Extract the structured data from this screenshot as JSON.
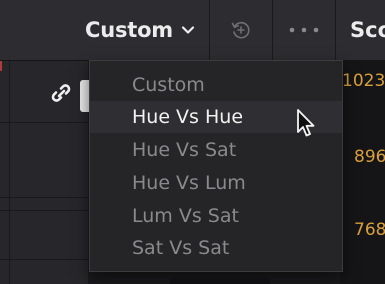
{
  "toolbar": {
    "dropdown_label": "Custom",
    "dropdown_icon": "chevron-down-icon",
    "reset_icon": "reset-icon",
    "more_icon": "more-options-icon",
    "scopes_tab_label": "Sco"
  },
  "dropdown_menu": {
    "items": [
      {
        "label": "Custom",
        "state": "disabled"
      },
      {
        "label": "Hue Vs Hue",
        "state": "hovered"
      },
      {
        "label": "Hue Vs Sat",
        "state": "normal"
      },
      {
        "label": "Hue Vs Lum",
        "state": "normal"
      },
      {
        "label": "Lum Vs Sat",
        "state": "normal"
      },
      {
        "label": "Sat Vs Sat",
        "state": "normal"
      }
    ]
  },
  "left_panel": {
    "link_icon": "link-icon"
  },
  "scope": {
    "labels": [
      "1023",
      "896",
      "768"
    ],
    "label_color": "#d9a03c"
  },
  "colors": {
    "toolbar_bg": "#2d2d31",
    "menu_bg": "#252528",
    "menu_text_active": "#f2f2f2",
    "menu_text_dim": "#8a8a8e"
  }
}
